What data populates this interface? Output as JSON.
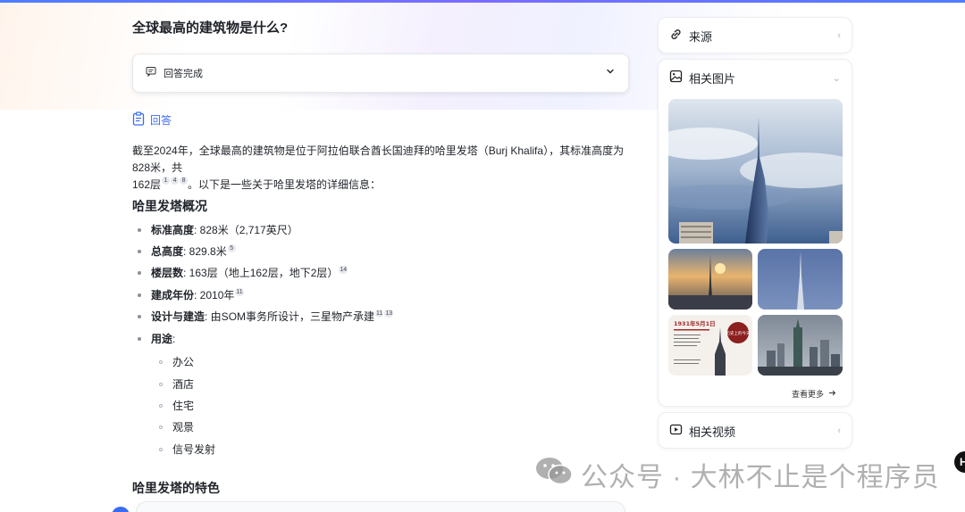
{
  "question": "全球最高的建筑物是什么?",
  "status": {
    "label": "回答完成"
  },
  "answer": {
    "heading": "回答",
    "intro_line1": "截至2024年，全球最高的建筑物是位于阿拉伯联合酋长国迪拜的哈里发塔（Burj Khalifa），其标准高度为828米，共",
    "intro_line2_a": "162层",
    "intro_refs": [
      "1",
      "4",
      "8"
    ],
    "intro_line2_b": "。以下是一些关于哈里发塔的详细信息："
  },
  "section1": {
    "title": "哈里发塔概况",
    "items": [
      {
        "key": "标准高度",
        "value": ": 828米（2,717英尺）",
        "refs": []
      },
      {
        "key": "总高度",
        "value": ": 829.8米",
        "refs": [
          "5"
        ]
      },
      {
        "key": "楼层数",
        "value": ": 163层（地上162层，地下2层）",
        "refs": [
          "14"
        ]
      },
      {
        "key": "建成年份",
        "value": ": 2010年",
        "refs": [
          "11"
        ]
      },
      {
        "key": "设计与建造",
        "value": ": 由SOM事务所设计，三星物产承建",
        "refs": [
          "11",
          "13"
        ]
      },
      {
        "key": "用途",
        "value": ":",
        "refs": []
      }
    ],
    "uses": [
      "办公",
      "酒店",
      "住宅",
      "观景",
      "信号发射"
    ]
  },
  "section2": {
    "title": "哈里发塔的特色"
  },
  "sidebar": {
    "sources": {
      "title": "来源"
    },
    "images": {
      "title": "相关图片",
      "more": "查看更多",
      "newspaper_date": "1931年5月1日",
      "stamp_text": "历史上的今天"
    },
    "videos": {
      "title": "相关视频"
    }
  },
  "watermark": "公众号 · 大林不止是个程序员",
  "colors": {
    "accent": "#3a6cf0",
    "text": "#1f2329"
  }
}
